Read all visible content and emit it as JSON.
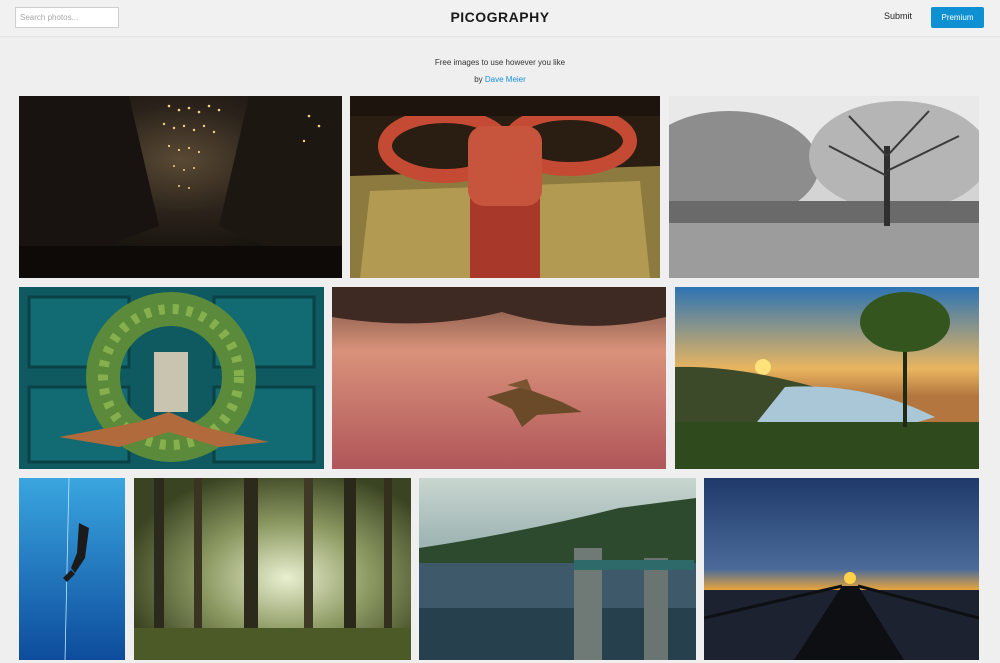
{
  "header": {
    "search_placeholder": "Search photos...",
    "logo": "PICOGRAPHY",
    "submit_label": "Submit",
    "premium_label": "Premium"
  },
  "intro": {
    "tagline": "Free images to use however you like",
    "by_prefix": "by",
    "author": "Dave Meier"
  },
  "colors": {
    "accent": "#0e90d2",
    "link": "#1a8fd8",
    "background": "#efefef"
  },
  "photos": [
    {
      "subject": "dark alley with string lights"
    },
    {
      "subject": "red glitter gift box with bow"
    },
    {
      "subject": "black and white winter park with tree"
    },
    {
      "subject": "christmas wreath on teal door"
    },
    {
      "subject": "leaf floating on pink water"
    },
    {
      "subject": "sunset over river valley"
    },
    {
      "subject": "diver in blue water"
    },
    {
      "subject": "misty forest trees"
    },
    {
      "subject": "lake with bridge and forest"
    },
    {
      "subject": "pier at sunset"
    }
  ]
}
